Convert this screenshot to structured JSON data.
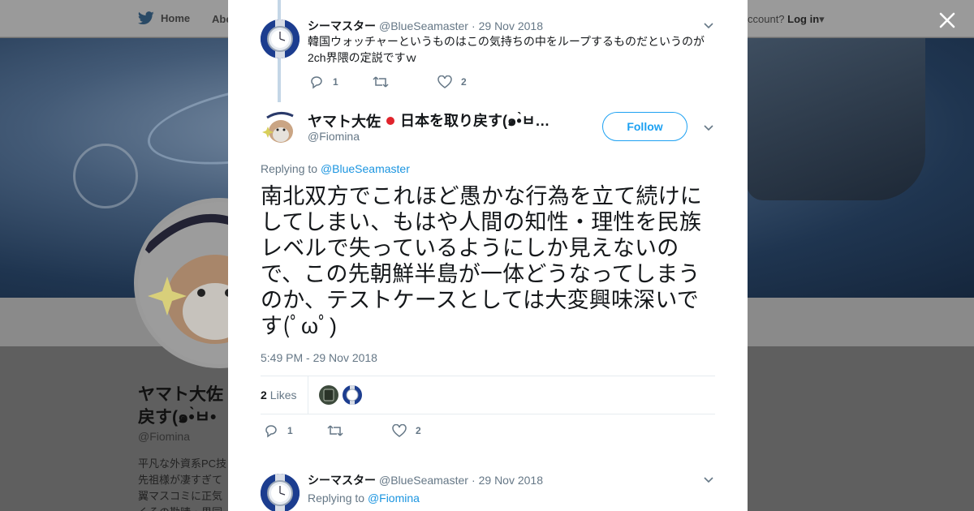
{
  "background": {
    "nav": {
      "home_label": "Home",
      "about_label": "Abo",
      "account_text": "ccount?",
      "login_label": "Log in"
    },
    "profile": {
      "name_line1": "ヤマト大佐",
      "name_line2": "戻す(๑•̀ㅂ•",
      "handle": "@Fiomina",
      "bio_lines": [
        "平凡な外資系PC技",
        "先祖様が凄すぎて",
        "翼マスコミに正気",
        "くその勘晴・果同"
      ]
    }
  },
  "thread": {
    "reply_tweet": {
      "name": "シーマスター",
      "handle": "@BlueSeamaster",
      "time": "29 Nov 2018",
      "text": "韓国ウォッチャーというものはこの気持ちの中をループするものだというのが2ch界隈の定説ですｗ",
      "reply_count": "1",
      "retweet_count": "",
      "like_count": "2"
    },
    "main_tweet": {
      "name": "ヤマト大佐",
      "name_rest": "日本を取り戻す(๑•̀ㅂ…",
      "handle": "@Fiomina",
      "follow_label": "Follow",
      "replying_prefix": "Replying to",
      "replying_to": "@BlueSeamaster",
      "text": "南北双方でこれほど愚かな行為を立て続けにしてしまい、もはや人間の知性・理性を民族レベルで失っているようにしか見えないので、この先朝鮮半島が一体どうなってしまうのか、テストケースとしては大変興味深いです(ﾟωﾟ)",
      "timestamp": "5:49 PM - 29 Nov 2018",
      "likes_count": "2",
      "likes_label": "Likes",
      "reply_count": "1",
      "retweet_count": "",
      "like_count": "2"
    },
    "next_tweet": {
      "name": "シーマスター",
      "handle": "@BlueSeamaster",
      "time": "29 Nov 2018",
      "replying_prefix": "Replying to",
      "replying_to": "@Fiomina"
    }
  },
  "colors": {
    "accent": "#1da1f2",
    "link": "#1b95e0",
    "muted": "#657786",
    "text": "#14171a"
  },
  "icons": [
    "twitter-bird-icon",
    "close-icon",
    "chevron-down-icon",
    "reply-icon",
    "retweet-icon",
    "heart-icon",
    "japan-flag-icon"
  ]
}
